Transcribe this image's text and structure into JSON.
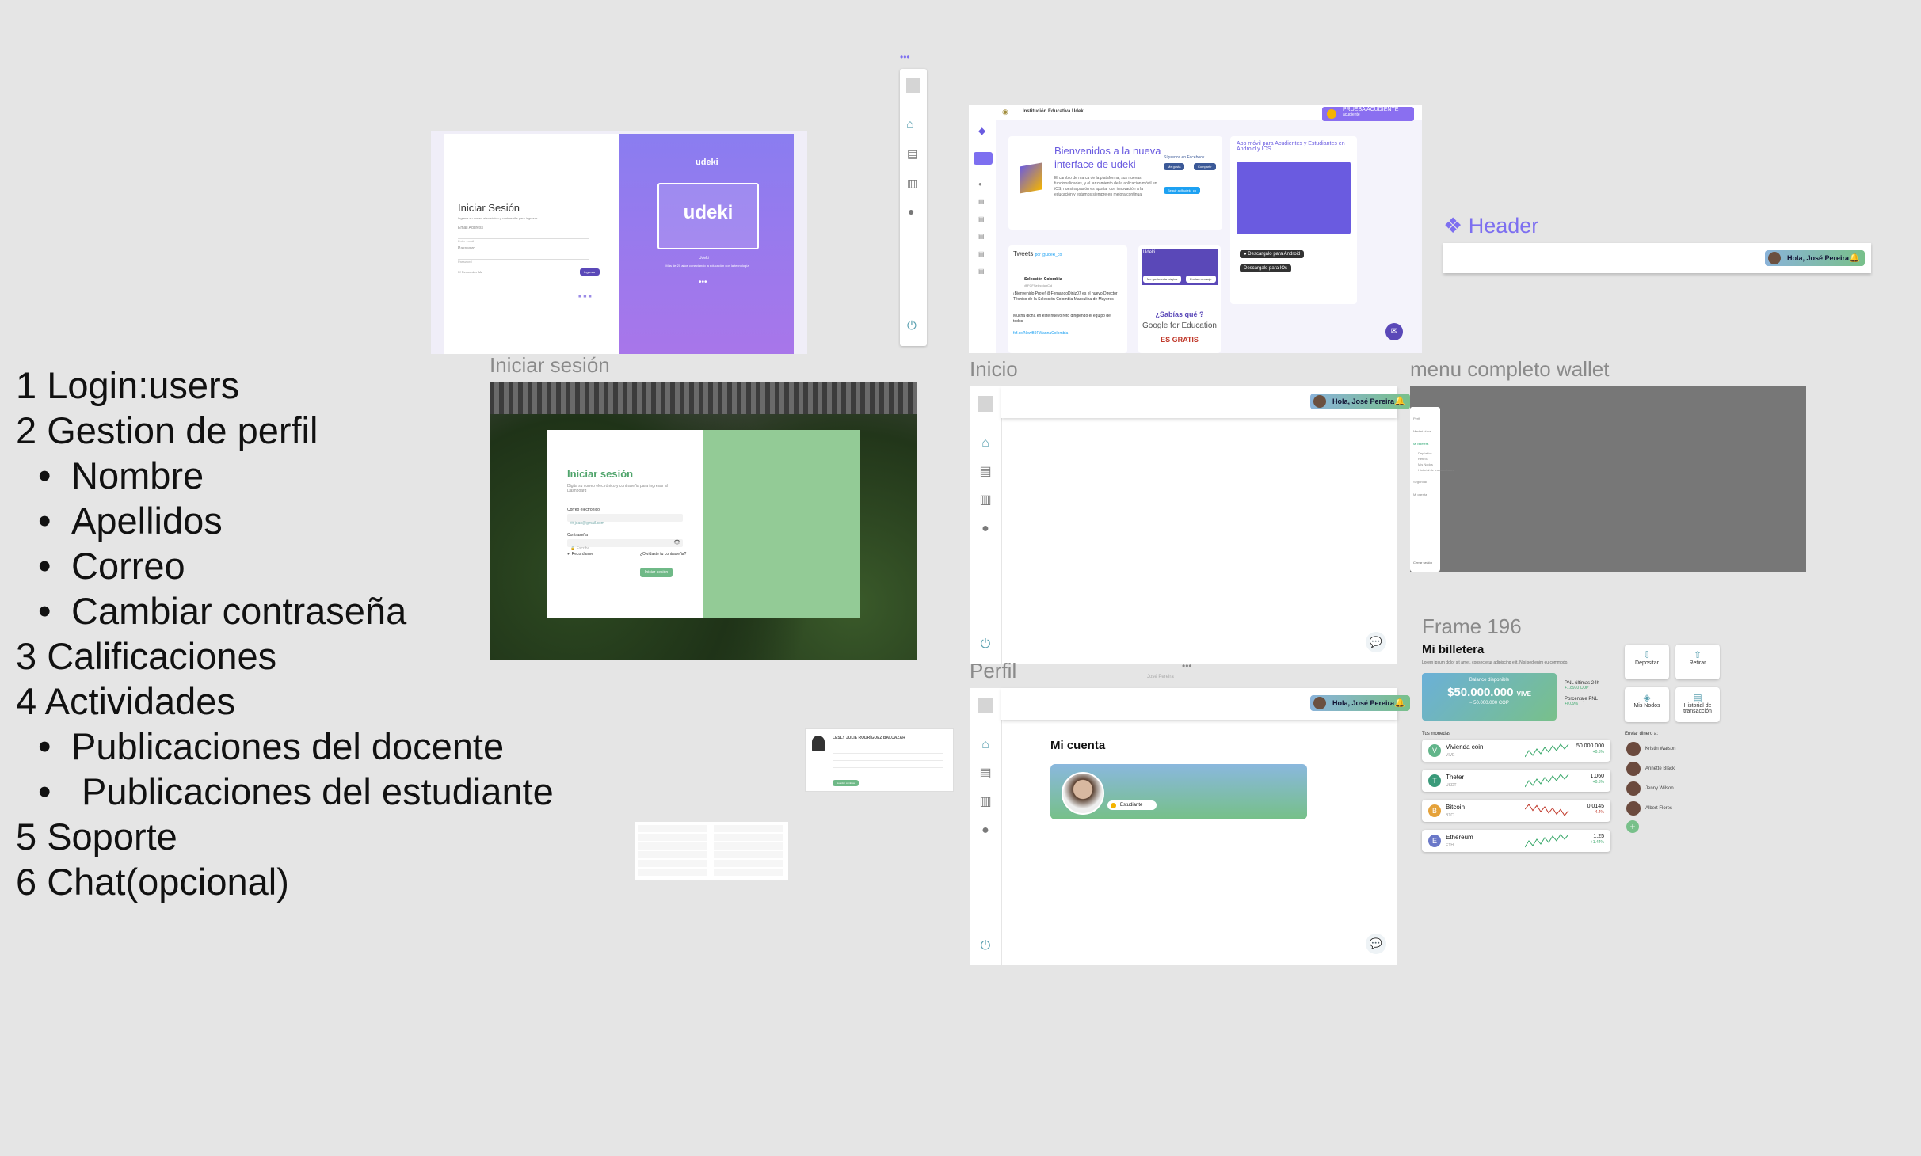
{
  "notes": {
    "lines": [
      {
        "text": "1 Login:users",
        "bullet": false
      },
      {
        "text": "2 Gestion de perfil",
        "bullet": false
      },
      {
        "text": "Nombre",
        "bullet": true
      },
      {
        "text": "Apellidos",
        "bullet": true
      },
      {
        "text": "Correo",
        "bullet": true
      },
      {
        "text": "Cambiar contraseña",
        "bullet": true
      },
      {
        "text": "3 Calificaciones",
        "bullet": false
      },
      {
        "text": "4 Actividades",
        "bullet": false
      },
      {
        "text": "Publicaciones del docente",
        "bullet": true
      },
      {
        "text": " Publicaciones del estudiante",
        "bullet": true
      },
      {
        "text": "5 Soporte",
        "bullet": false
      },
      {
        "text": "6 Chat(opcional)",
        "bullet": false
      }
    ]
  },
  "frame_labels": {
    "iniciar_sesion": "Iniciar sesión",
    "inicio": "Inicio",
    "menu_wallet": "menu completo wallet",
    "perfil": "Perfil",
    "frame196": "Frame 196",
    "header": "Header"
  },
  "old_login": {
    "title": "Iniciar Sesión",
    "subtitle": "Ingrese su correo electrónico y contraseña para ingresar",
    "email_label": "Email Address",
    "email_placeholder": "Enter email",
    "password_label": "Password",
    "password_placeholder": "Password",
    "remember": "Remember Me",
    "submit": "Ingresar",
    "brand": "udeki",
    "brand_sub": "Udeki",
    "brand_caption": "Más de 20 años conectando la educación con la tecnología"
  },
  "old_home": {
    "school": "Institución Educativa Udeki",
    "badge_title": "PRUEBA ACUDIENTE",
    "badge_sub": "acudiente",
    "welcome_title": "Bienvenidos a la nueva interface de udeki",
    "welcome_body": "El cambio de marca de la plataforma, sus nuevas funcionalidades, y el lanzamiento de la aplicación móvil en iOS, nuestra pasión es aportar con innovación a la educación y estamos siempre en mejora continua.",
    "facebook": "Síguenos en Facebook",
    "like": "Me gusta",
    "share": "Compartir",
    "follow": "Seguir a @udeki_co",
    "app_title": "App móvil para Acudientes y Estudiantes en Android y IOS",
    "android": "Descargalo para Android",
    "ios": "Descargalo para IOs",
    "tweets": "Tweets",
    "tweets_by": "por @udeki_co",
    "tweet_author": "Selección Colombia",
    "tweet_handle": "@FCFSeleccionCol",
    "tweet_text": "¡Bienvenido Profe! @FernandoDiniz07 es el nuevo Director Técnico de la Selección Colombia Masculina de Mayores",
    "tweet_more": "Mucha dicha en este nuevo reto dirigiendo el equipo de todos",
    "tweet_link": "fcf.co/NpwB9FWannaColombia",
    "fb_page": "Udeki",
    "fb_like": "Me gusta esta página",
    "fb_send": "Enviar mensaje",
    "sabias": "¿Sabías qué ?",
    "gfe": "Google for Education",
    "gratis": "ES GRATIS"
  },
  "header_frame": {
    "greeting": "Hola, José Pereira"
  },
  "login": {
    "title": "Iniciar sesión",
    "subtitle": "Digita su correo electrónico y contraseña para ingresar al Dashboard",
    "email_label": "Correo electrónico",
    "email_placeholder": "joao@gmail.com",
    "password_label": "Contraseña",
    "password_placeholder": "Escriba",
    "remember": "Recordarme",
    "forgot": "¿Olvidaste tu contraseña?",
    "submit": "Iniciar sesión"
  },
  "inicio": {
    "greeting": "Hola, José Pereira"
  },
  "perfil": {
    "greeting": "Hola, José Pereira",
    "title": "Mi cuenta",
    "role": "Estudiante",
    "floating": "José Pereira"
  },
  "wallet_menu": {
    "items": [
      "Perfil",
      "Market place",
      "Mi billetera",
      "Depósitos",
      "Retiros",
      "Mis Nodos",
      "Historial de transacciones",
      "Seguridad",
      "Mi cuenta"
    ],
    "logout": "Cerrar sesión"
  },
  "wallet": {
    "title": "Mi billetera",
    "subtitle": "Lorem ipsum dolor sit amet, consectetur adipiscing elit. Nisi sed enim eu commodo.",
    "balance_label": "Balance disponible",
    "balance": "$50.000.000",
    "balance_unit": "VIVE",
    "balance_cop": "≈ 50.000.000 COP",
    "pnl_label": "PNL últimas 24h",
    "pnl_value": "+1.8970 COP",
    "pnl_pct_label": "Porcentaje PNL",
    "pnl_pct": "+0.09%",
    "monedas_title": "Tus monedas",
    "coins": [
      {
        "name": "Vivienda coin",
        "sym": "VIVE",
        "amount": "50.000.000",
        "change": "+0.5%",
        "color": "#62b58a",
        "trend": "up"
      },
      {
        "name": "Theter",
        "sym": "USDT",
        "amount": "1.060",
        "change": "+0.5%",
        "color": "#3a9a7a",
        "trend": "up"
      },
      {
        "name": "Bitcoin",
        "sym": "BTC",
        "amount": "0.0145",
        "change": "-4.4%",
        "color": "#e5a23a",
        "trend": "down"
      },
      {
        "name": "Ethereum",
        "sym": "ETH",
        "amount": "1.25",
        "change": "+1.44%",
        "color": "#6a78c8",
        "trend": "up"
      }
    ],
    "actions": [
      {
        "label": "Depositar",
        "icon": "⇩"
      },
      {
        "label": "Retirar",
        "icon": "⇧"
      },
      {
        "label": "Mis Nodos",
        "icon": "◈"
      },
      {
        "label": "Historial de transacción",
        "icon": "▤"
      }
    ],
    "enviar_title": "Enviar dinero a:",
    "contacts": [
      "Kristin Watson",
      "Annette Black",
      "Jenny Wilson",
      "Albert Flores"
    ]
  },
  "mini_profile": {
    "name": "LESLY JULIE RODRÍGUEZ BALCAZAR",
    "button": "Guardar cambios"
  },
  "colors": {
    "udeki_purple": "#8a6ff0",
    "login_green": "#93cb96",
    "accent_green": "#62b58a",
    "header_blue": "#8ab3d9"
  }
}
